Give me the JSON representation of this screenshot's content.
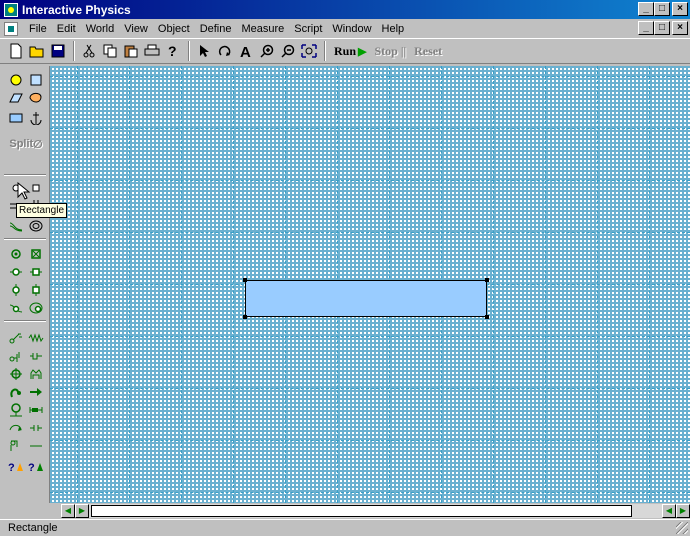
{
  "window": {
    "title": "Interactive Physics",
    "min": "_",
    "max": "□",
    "close": "×"
  },
  "menu": {
    "items": [
      {
        "label": "File"
      },
      {
        "label": "Edit"
      },
      {
        "label": "World"
      },
      {
        "label": "View"
      },
      {
        "label": "Object"
      },
      {
        "label": "Define"
      },
      {
        "label": "Measure"
      },
      {
        "label": "Script"
      },
      {
        "label": "Window"
      },
      {
        "label": "Help"
      }
    ]
  },
  "toolbar": {
    "run": "Run",
    "stop": "Stop",
    "reset": "Reset",
    "stop_glyph": "||"
  },
  "palette": {
    "split_label": "Split",
    "tooltip": "Rectangle"
  },
  "status": {
    "text": "Rectangle"
  },
  "colors": {
    "rect_fill": "#99ccff",
    "grid": "#3aa0c8",
    "titlebar": "#000080"
  }
}
